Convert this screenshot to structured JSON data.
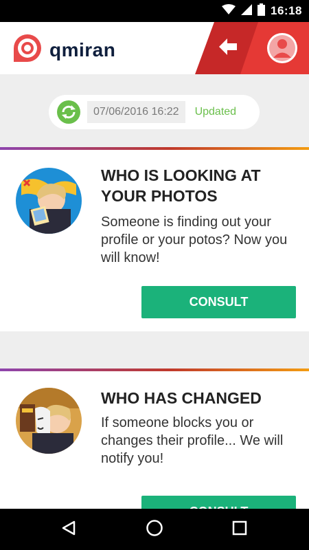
{
  "status_bar": {
    "time": "16:18"
  },
  "header": {
    "logo_text": "qmiran",
    "colors": {
      "brand_red": "#e84a4a",
      "band_dark": "#c62828",
      "band_light": "#e53935"
    }
  },
  "update": {
    "date": "07/06/2016 16:22",
    "status": "Updated",
    "status_color": "#6abf4b"
  },
  "cards": [
    {
      "title": "WHO IS LOOKING AT YOUR PHOTOS",
      "description": "Someone is finding out your profile or your potos? Now you will know!",
      "button": "CONSULT"
    },
    {
      "title": "WHO HAS CHANGED",
      "description": "If someone blocks you or changes their profile... We will notify you!",
      "button": "CONSULT"
    }
  ],
  "icons": {
    "status": [
      "wifi-icon",
      "signal-icon",
      "battery-icon"
    ],
    "nav": [
      "back-triangle-icon",
      "home-circle-icon",
      "recents-square-icon"
    ]
  }
}
